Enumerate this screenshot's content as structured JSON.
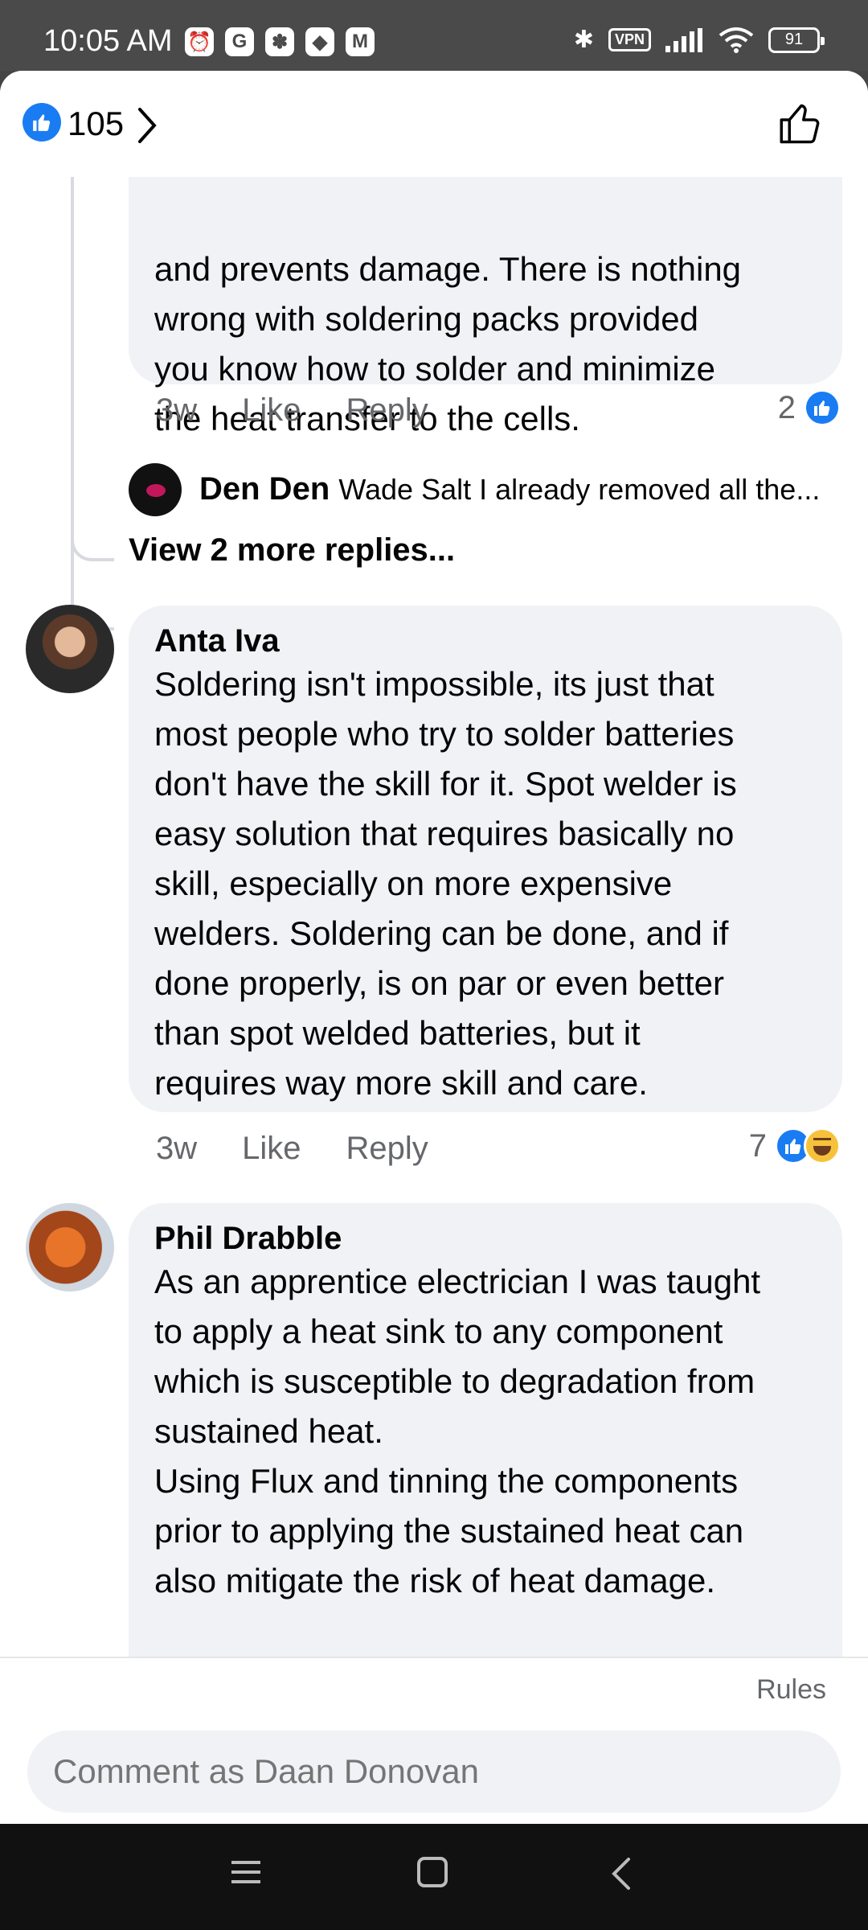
{
  "status_bar": {
    "time": "10:05 AM",
    "vpn": "VPN",
    "battery": "91",
    "apps": [
      "G",
      "✽",
      "◆",
      "M"
    ]
  },
  "header": {
    "like_count": "105"
  },
  "thread": {
    "partial_comment": {
      "body": "and prevents damage. There is nothing\nwrong with soldering packs provided\nyou know how to solder and minimize\nthe heat transfer to the cells.",
      "time": "3w",
      "like_label": "Like",
      "reply_label": "Reply",
      "reaction_count": "2"
    },
    "reply_preview": {
      "author": "Den Den",
      "text": "Wade Salt I already removed all the..."
    },
    "more_replies": "View 2 more replies..."
  },
  "comments": [
    {
      "author": "Anta Iva",
      "body": "Soldering isn't impossible, its just that\nmost people who try to solder batteries\ndon't have the skill for it. Spot welder is\neasy solution that requires basically no\nskill, especially on more expensive\nwelders. Soldering can be done, and if\ndone properly, is on par or even better\nthan spot welded batteries, but it\nrequires way more skill and care.",
      "time": "3w",
      "like_label": "Like",
      "reply_label": "Reply",
      "reaction_count": "7"
    },
    {
      "author": "Phil Drabble",
      "body": "As an apprentice electrician I was taught\nto apply a heat sink to any component\nwhich is susceptible to degradation from\nsustained heat.\nUsing Flux and tinning the components\nprior to applying the sustained heat can\nalso mitigate the risk of heat damage."
    }
  ],
  "footer": {
    "rules": "Rules",
    "comment_placeholder": "Comment as Daan Donovan"
  },
  "colors": {
    "accent": "#1a7cf2",
    "bubble": "#f0f2f5",
    "secondary_text": "#65676b"
  }
}
